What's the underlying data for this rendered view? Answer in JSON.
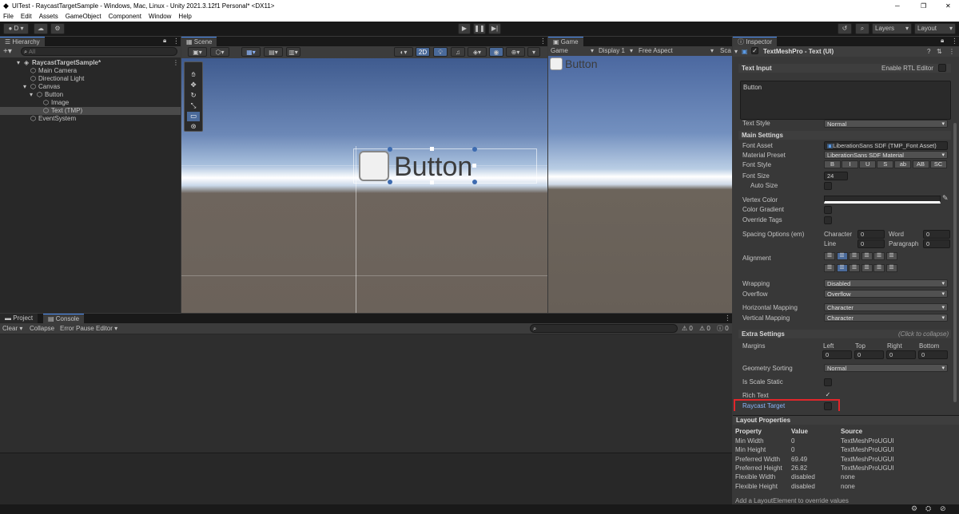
{
  "window": {
    "title": "UITest - RaycastTargetSample - Windows, Mac, Linux - Unity 2021.3.12f1 Personal* <DX11>",
    "controls": [
      "─",
      "❐",
      "✕"
    ]
  },
  "menu": [
    "File",
    "Edit",
    "Assets",
    "GameObject",
    "Component",
    "Window",
    "Help"
  ],
  "toolbar": {
    "account": "D",
    "layers": "Layers",
    "layout": "Layout"
  },
  "hierarchy": {
    "tab": "Hierarchy",
    "search_placeholder": "All",
    "items": [
      {
        "label": "RaycastTargetSample*",
        "depth": 0,
        "bold": true
      },
      {
        "label": "Main Camera",
        "depth": 1
      },
      {
        "label": "Directional Light",
        "depth": 1
      },
      {
        "label": "Canvas",
        "depth": 1
      },
      {
        "label": "Button",
        "depth": 2
      },
      {
        "label": "Image",
        "depth": 3
      },
      {
        "label": "Text (TMP)",
        "depth": 3,
        "selected": true
      },
      {
        "label": "EventSystem",
        "depth": 1
      }
    ]
  },
  "scene": {
    "tab": "Scene",
    "mode_2d": "2D",
    "button_text": "Button"
  },
  "game": {
    "tab": "Game",
    "mode": "Game",
    "display": "Display 1",
    "aspect": "Free Aspect",
    "scale": "Sca",
    "button_text": "Button"
  },
  "console": {
    "tabs": [
      "Project",
      "Console"
    ],
    "toolbar": [
      "Clear",
      "Collapse",
      "Error Pause",
      "Editor"
    ],
    "counts": {
      "warn": "0",
      "error": "0",
      "info": "0"
    }
  },
  "inspector": {
    "tab": "Inspector",
    "component": "TextMeshPro - Text (UI)",
    "text_input_label": "Text Input",
    "enable_rtl": "Enable RTL Editor",
    "text_value": "Button",
    "text_style_label": "Text Style",
    "text_style": "Normal",
    "main_settings": "Main Settings",
    "font_asset_label": "Font Asset",
    "font_asset": "LiberationSans SDF (TMP_Font Asset)",
    "material_preset_label": "Material Preset",
    "material_preset": "LiberationSans SDF Material",
    "font_style_label": "Font Style",
    "font_styles": [
      "B",
      "I",
      "U",
      "S",
      "ab",
      "AB",
      "SC"
    ],
    "font_size_label": "Font Size",
    "font_size": "24",
    "auto_size_label": "Auto Size",
    "vertex_color_label": "Vertex Color",
    "color_gradient_label": "Color Gradient",
    "override_tags_label": "Override Tags",
    "spacing_label": "Spacing Options (em)",
    "character_label": "Character",
    "character": "0",
    "word_label": "Word",
    "word": "0",
    "line_label": "Line",
    "line": "0",
    "paragraph_label": "Paragraph",
    "paragraph": "0",
    "alignment_label": "Alignment",
    "wrapping_label": "Wrapping",
    "wrapping": "Disabled",
    "overflow_label": "Overflow",
    "overflow": "Overflow",
    "hmap_label": "Horizontal Mapping",
    "hmap": "Character",
    "vmap_label": "Vertical Mapping",
    "vmap": "Character",
    "extra_settings": "Extra Settings",
    "collapse_hint": "(Click to collapse)",
    "margins_label": "Margins",
    "margins": {
      "left_label": "Left",
      "left": "0",
      "top_label": "Top",
      "top": "0",
      "right_label": "Right",
      "right": "0",
      "bottom_label": "Bottom",
      "bottom": "0"
    },
    "geometry_label": "Geometry Sorting",
    "geometry": "Normal",
    "scale_static_label": "Is Scale Static",
    "rich_text_label": "Rich Text",
    "rich_text": "✓",
    "raycast_label": "Raycast Target",
    "highlight_color": "#e0262b"
  },
  "layout_props": {
    "title": "Layout Properties",
    "headers": [
      "Property",
      "Value",
      "Source"
    ],
    "rows": [
      [
        "Min Width",
        "0",
        "TextMeshProUGUI"
      ],
      [
        "Min Height",
        "0",
        "TextMeshProUGUI"
      ],
      [
        "Preferred Width",
        "69.49",
        "TextMeshProUGUI"
      ],
      [
        "Preferred Height",
        "26.82",
        "TextMeshProUGUI"
      ],
      [
        "Flexible Width",
        "disabled",
        "none"
      ],
      [
        "Flexible Height",
        "disabled",
        "none"
      ]
    ],
    "footer": "Add a LayoutElement to override values"
  }
}
